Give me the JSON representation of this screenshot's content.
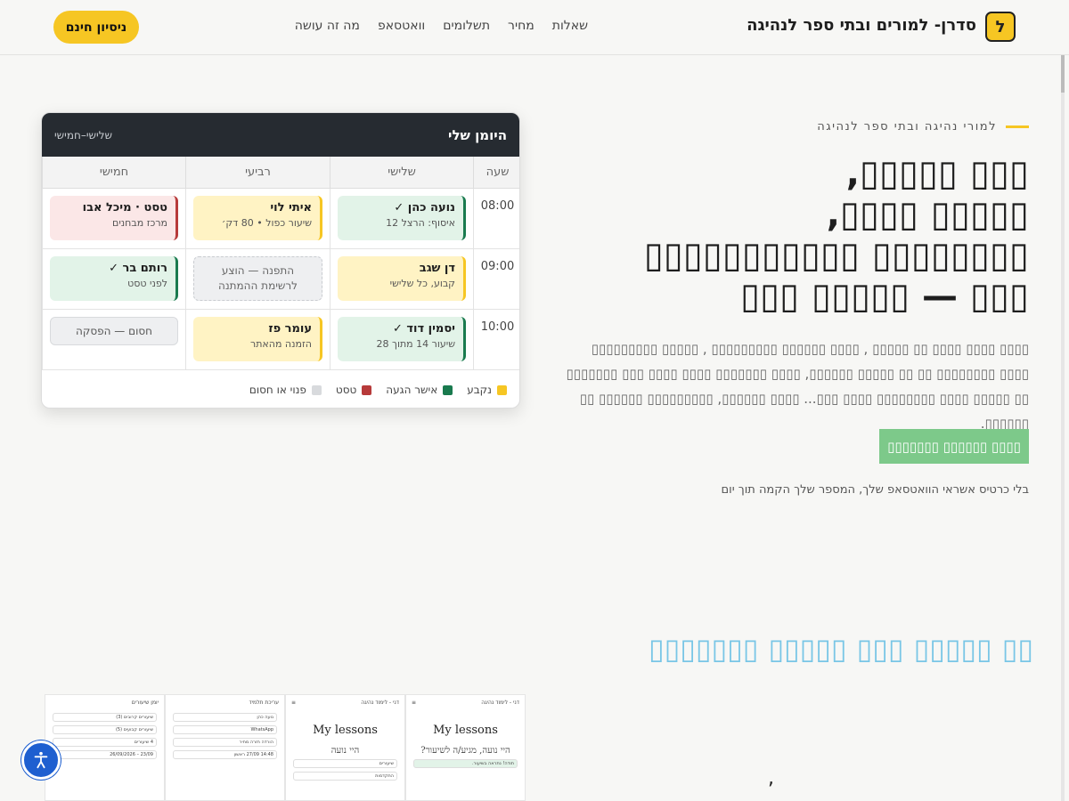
{
  "header": {
    "logo_letter": "ל",
    "brand": "סדרן- למורים ובתי ספר לנהיגה",
    "nav": [
      "מה זה עושה",
      "וואטסאפ",
      "תשלומים",
      "מחיר",
      "שאלות"
    ],
    "cta": "ניסיון חינם"
  },
  "hero": {
    "eyebrow": "למורי נהיגה ובתי ספר לנהיגה",
    "title": "▯▯▯ ▯▯▯▯▯,\n▯▯▯▯▯ ▯▯▯▯,\n▯▯▯▯▯▯▯▯ ▯▯▯▯▯▯▯▯▯▯▯\n▯▯▯ — ▯▯▯▯▯ ▯▯▯",
    "description": "▯▯▯▯ ▯▯▯▯ ▯▯▯▯ ▯▯ ▯▯▯▯▯ , ▯▯▯▯ ▯▯▯▯▯▯ ▯▯▯▯▯▯▯▯▯ , ▯▯▯▯▯ ▯▯▯▯▯▯▯▯▯ ▯▯▯▯ ▯▯▯▯▯▯▯▯ ▯▯ ▯▯ ▯▯▯▯▯ ▯▯▯▯▯▯, ▯▯▯▯ ▯▯▯▯▯▯▯ ▯▯▯▯ ▯▯▯▯ ▯▯▯ ▯▯▯▯▯▯▯ ▯▯ ▯▯▯▯▯ ▯▯▯▯ ▯▯▯▯▯▯▯▯ ▯▯▯▯ ▯▯▯... ▯▯▯▯ ▯▯▯▯▯▯, ▯▯▯▯▯▯▯▯▯ ▯▯▯▯▯▯ ▯▯ ▯▯▯▯▯▯.",
    "cta": "▯▯▯▯▯▯▯ ▯▯▯▯▯▯ ▯▯▯▯",
    "note": "בלי כרטיס אשראי הוואטסאפ שלך, המספר שלך הקמה תוך יום"
  },
  "diary": {
    "title": "היומן שלי",
    "range": "שלישי–חמישי",
    "columns": [
      "חמישי",
      "רביעי",
      "שלישי",
      "שעה"
    ],
    "times": [
      "08:00",
      "09:00",
      "10:00"
    ],
    "rows": [
      {
        "thu": {
          "name": "טסט · מיכל אבו",
          "sub": "מרכז מבחנים",
          "kind": "test"
        },
        "wed": {
          "name": "איתי לוי",
          "sub": "שיעור כפול • 80 דק׳",
          "kind": "fixed"
        },
        "tue": {
          "name": "נועה כהן ✓",
          "sub": "איסוף: הרצל 12",
          "kind": "conf"
        }
      },
      {
        "thu": {
          "name": "רותם בר ✓",
          "sub": "לפני טסט",
          "kind": "conf"
        },
        "wed": {
          "text": "התפנה — הוצע לרשימת ההמתנה",
          "kind": "free"
        },
        "tue": {
          "name": "דן שגב",
          "sub": "קבוע, כל שלישי",
          "kind": "fixed"
        }
      },
      {
        "thu": {
          "text": "חסום — הפסקה",
          "kind": "block"
        },
        "wed": {
          "name": "עומר פז",
          "sub": "הזמנה מהאתר",
          "kind": "fixed"
        },
        "tue": {
          "name": "יסמין דוד ✓",
          "sub": "שיעור 14 מתוך 28",
          "kind": "conf"
        }
      }
    ],
    "legend": [
      {
        "label": "נקבע",
        "color": "#f6c623"
      },
      {
        "label": "אישר הגעה",
        "color": "#197a4e"
      },
      {
        "label": "טסט",
        "color": "#b73a3a"
      },
      {
        "label": "פנוי או חסום",
        "color": "#d8dadd"
      }
    ]
  },
  "section2": {
    "title": "▯▯ ▯▯▯▯▯ ▯▯▯ ▯▯▯▯▯ ▯▯▯▯▯▯▯",
    "comma": ","
  },
  "shots": [
    {
      "bar": "יומן שיעורים",
      "rows": [
        "שיעורים קרובים (3)",
        "שיעורים קבועים (5)",
        "4 שיעורים",
        "23/09 – 26/09/2026"
      ]
    },
    {
      "bar": "עריכת תלמיד",
      "rows": [
        "נועה כהן",
        "WhatsApp",
        "הורדה חזרה מחיר",
        "14:48 27/09 ראשון"
      ]
    },
    {
      "bar": "דני - לימוד נהיגה",
      "big": "My lessons",
      "sub": "היי נועה",
      "rows": [
        "שיעורים",
        "התקדמות",
        "תשלומים"
      ]
    },
    {
      "bar": "דני - לימוד נהיגה",
      "big": "My lessons",
      "sub": "היי נועה, מגיע/ה לשיעור?",
      "rows": [
        "תודה! נתראה בשיעור."
      ]
    }
  ],
  "a11y": "accessibility-icon"
}
